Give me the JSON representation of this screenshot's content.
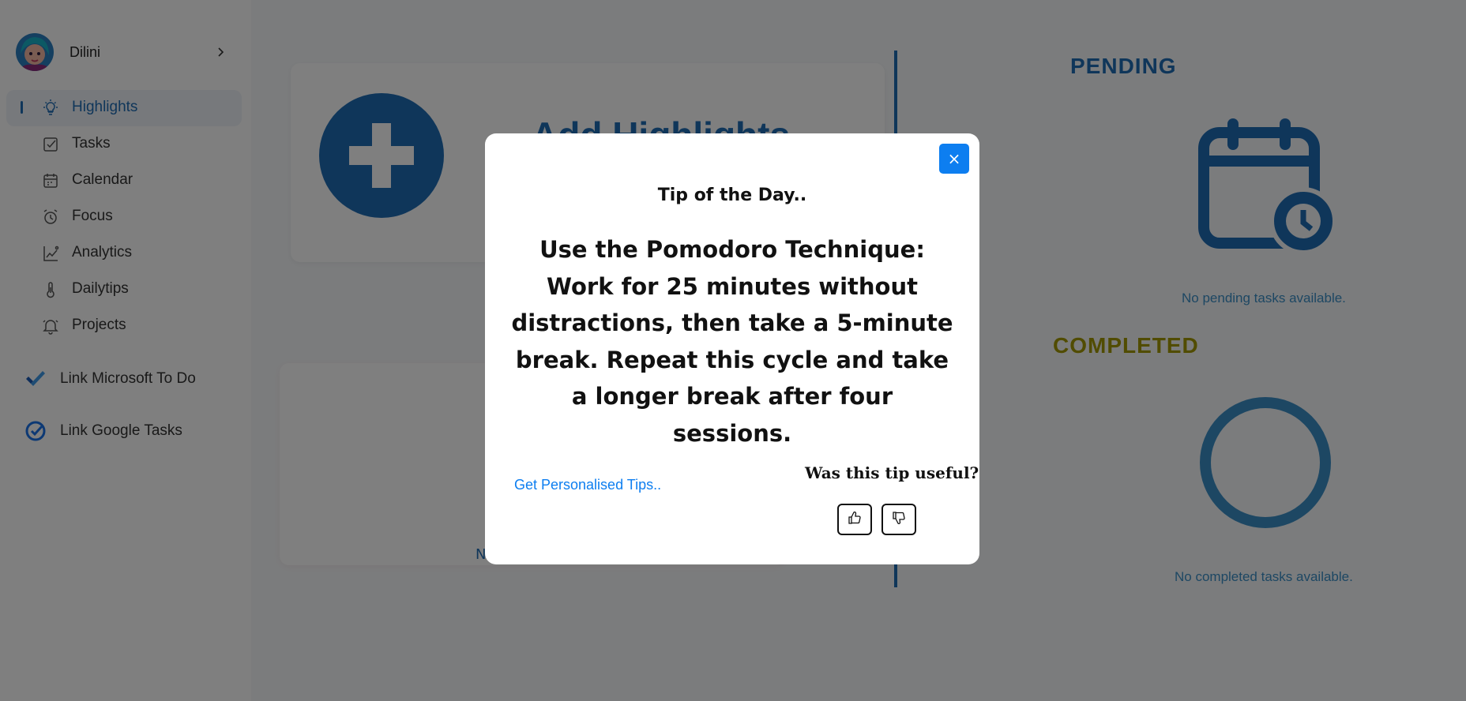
{
  "user": {
    "name": "Dilini"
  },
  "sidebar": {
    "items": [
      {
        "label": "Highlights",
        "icon": "lightbulb-icon",
        "active": true
      },
      {
        "label": "Tasks",
        "icon": "checkbox-icon"
      },
      {
        "label": "Calendar",
        "icon": "calendar-icon"
      },
      {
        "label": "Focus",
        "icon": "alarm-clock-icon"
      },
      {
        "label": "Analytics",
        "icon": "analytics-chart-icon"
      },
      {
        "label": "Dailytips",
        "icon": "thermometer-icon"
      },
      {
        "label": "Projects",
        "icon": "bell-icon"
      }
    ],
    "links": [
      {
        "label": "Link Microsoft To Do",
        "icon": "microsoft-todo-check-icon"
      },
      {
        "label": "Link Google Tasks",
        "icon": "google-tasks-icon"
      }
    ]
  },
  "main": {
    "highlight_card_title": "Add Highlights",
    "faint_card_text": "N"
  },
  "right_panel": {
    "pending": {
      "title": "PENDING",
      "empty_text": "No pending tasks available."
    },
    "completed": {
      "title": "COMPLETED",
      "empty_text": "No completed tasks available."
    }
  },
  "modal": {
    "close_label": "×",
    "heading": "Tip of the Day..",
    "tip": "Use the Pomodoro Technique: Work for 25 minutes without distractions, then take a 5-minute break. Repeat this cycle and take a longer break after four sessions.",
    "personalised_link": "Get Personalised Tips..",
    "feedback_question": "Was this tip useful?"
  },
  "colors": {
    "accent": "#1f6cb5",
    "completed": "#a39800",
    "primary_button": "#0d7ef0",
    "overlay": "rgba(0,0,0,0.5)"
  }
}
